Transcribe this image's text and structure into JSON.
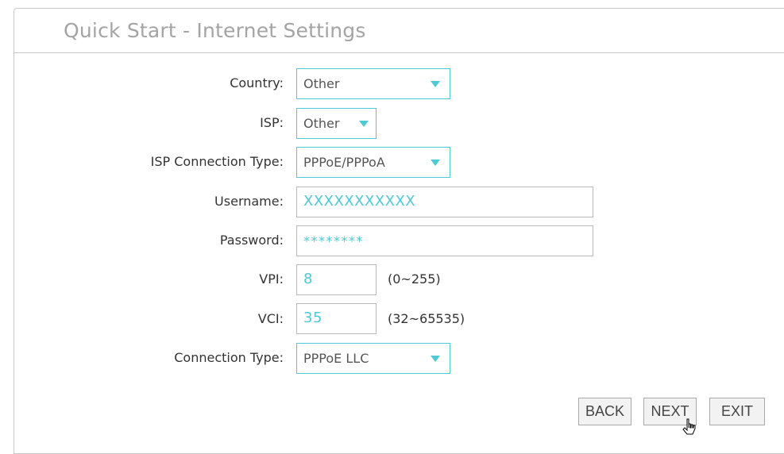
{
  "header": {
    "title": "Quick Start - Internet Settings"
  },
  "form": {
    "country": {
      "label": "Country:",
      "value": "Other"
    },
    "isp": {
      "label": "ISP:",
      "value": "Other"
    },
    "isp_connection_type": {
      "label": "ISP Connection Type:",
      "value": "PPPoE/PPPoA"
    },
    "username": {
      "label": "Username:",
      "value": "XXXXXXXXXXX"
    },
    "password": {
      "label": "Password:",
      "value": "********"
    },
    "vpi": {
      "label": "VPI:",
      "value": "8",
      "range": "(0~255)"
    },
    "vci": {
      "label": "VCI:",
      "value": "35",
      "range": "(32~65535)"
    },
    "connection_type": {
      "label": "Connection Type:",
      "value": "PPPoE LLC"
    }
  },
  "buttons": {
    "back": "BACK",
    "next": "NEXT",
    "exit": "EXIT"
  },
  "colors": {
    "accent": "#4acbd6",
    "border": "#c8c8c8",
    "title": "#a4a4a4"
  },
  "icons": {
    "dropdown": "triangle-down-icon",
    "cursor": "mouse-pointer-icon"
  }
}
